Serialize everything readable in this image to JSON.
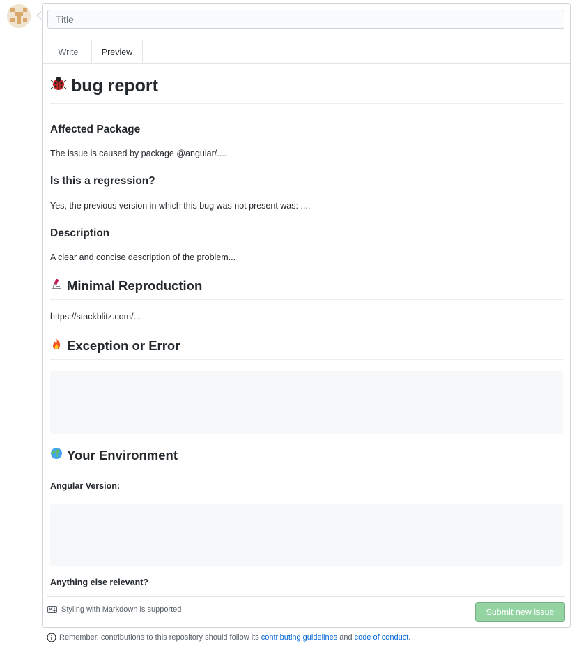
{
  "title_field": {
    "placeholder": "Title",
    "value": ""
  },
  "tabs": [
    {
      "label": "Write",
      "active": false
    },
    {
      "label": "Preview",
      "active": true
    }
  ],
  "preview": {
    "h1": {
      "emoji": "ladybug",
      "text": "bug report"
    },
    "sections": {
      "affected_heading": "Affected Package",
      "affected_text": "The issue is caused by package @angular/....",
      "regression_heading": "Is this a regression?",
      "regression_text": "Yes, the previous version in which this bug was not present was: ....",
      "description_heading": "Description",
      "description_text": "A clear and concise description of the problem...",
      "repro_heading": "Minimal Reproduction",
      "repro_emoji": "microscope",
      "repro_text": "https://stackblitz.com/...",
      "error_heading": "Exception or Error",
      "error_emoji": "fire",
      "env_heading": "Your Environment",
      "env_emoji": "globe",
      "angular_version_label": "Angular Version:",
      "anything_else_label": "Anything else relevant?"
    }
  },
  "footer": {
    "markdown_hint": "Styling with Markdown is supported",
    "submit_label": "Submit new issue",
    "submit_color": "#94d3a2"
  },
  "notice": {
    "prefix": "Remember, contributions to this repository should follow its",
    "link1": "contributing guidelines",
    "middle": "and",
    "link2": "code of conduct",
    "suffix": "."
  }
}
